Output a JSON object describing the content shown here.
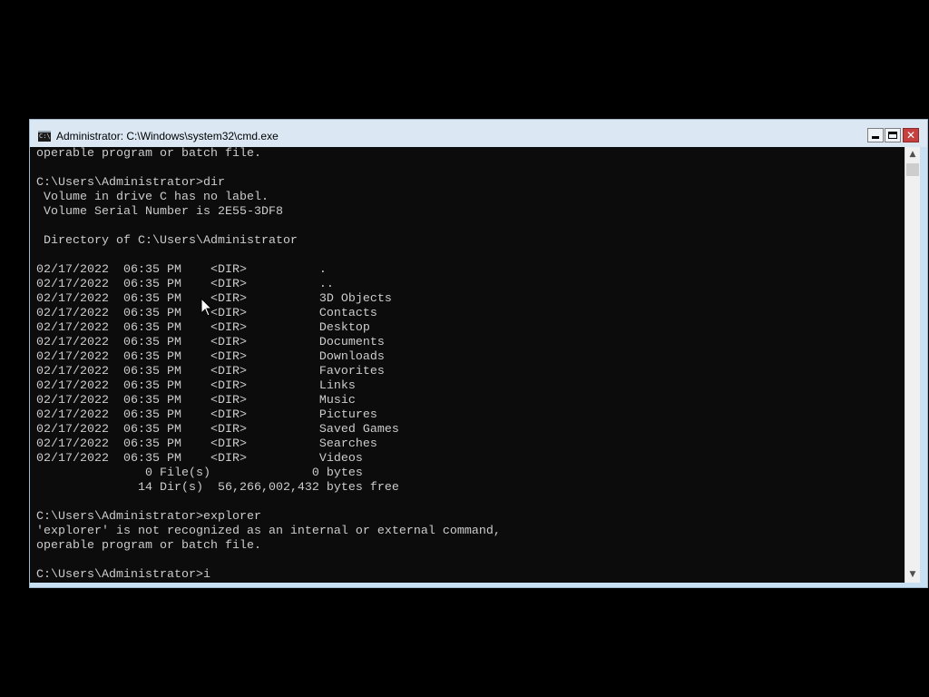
{
  "window": {
    "title": "Administrator: C:\\Windows\\system32\\cmd.exe",
    "icon": "cmd-icon",
    "icon_text": "C:\\",
    "buttons": {
      "minimize": "minimize-icon",
      "maximize": "maximize-icon",
      "close": "close-icon",
      "close_glyph": "✕"
    }
  },
  "console": {
    "lines": [
      "operable program or batch file.",
      "",
      "C:\\Users\\Administrator>dir",
      " Volume in drive C has no label.",
      " Volume Serial Number is 2E55-3DF8",
      "",
      " Directory of C:\\Users\\Administrator",
      "",
      "02/17/2022  06:35 PM    <DIR>          .",
      "02/17/2022  06:35 PM    <DIR>          ..",
      "02/17/2022  06:35 PM    <DIR>          3D Objects",
      "02/17/2022  06:35 PM    <DIR>          Contacts",
      "02/17/2022  06:35 PM    <DIR>          Desktop",
      "02/17/2022  06:35 PM    <DIR>          Documents",
      "02/17/2022  06:35 PM    <DIR>          Downloads",
      "02/17/2022  06:35 PM    <DIR>          Favorites",
      "02/17/2022  06:35 PM    <DIR>          Links",
      "02/17/2022  06:35 PM    <DIR>          Music",
      "02/17/2022  06:35 PM    <DIR>          Pictures",
      "02/17/2022  06:35 PM    <DIR>          Saved Games",
      "02/17/2022  06:35 PM    <DIR>          Searches",
      "02/17/2022  06:35 PM    <DIR>          Videos",
      "               0 File(s)              0 bytes",
      "              14 Dir(s)  56,266,002,432 bytes free",
      "",
      "C:\\Users\\Administrator>explorer",
      "'explorer' is not recognized as an internal or external command,",
      "operable program or batch file.",
      "",
      "C:\\Users\\Administrator>i"
    ]
  },
  "scrollbar": {
    "up_glyph": "▲",
    "down_glyph": "▼"
  },
  "colors": {
    "desktop": "#000000",
    "console_bg": "#0c0c0c",
    "console_text": "#cccccc",
    "titlebar": "#dbe8f4",
    "close_button": "#c74040"
  }
}
